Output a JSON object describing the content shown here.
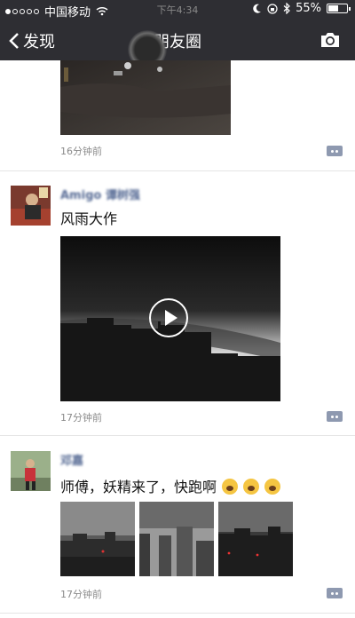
{
  "status": {
    "carrier": "中国移动",
    "time": "下午4:34",
    "battery": "55%",
    "battery_level": 0.55
  },
  "nav": {
    "back_label": "发现",
    "title": "朋友圈"
  },
  "posts": [
    {
      "time": "16分钟前"
    },
    {
      "name": "Amigo 谭树强",
      "text": "风雨大作",
      "time": "17分钟前"
    },
    {
      "name": "邓嘉",
      "text": "师傅，妖精来了，快跑啊",
      "time": "17分钟前"
    }
  ],
  "colors": {
    "bar": "#2e2e33",
    "name": "#576b95",
    "time": "#8a8a8a"
  },
  "icons": [
    "back-chevron-icon",
    "camera-icon",
    "wifi-icon",
    "moon-icon",
    "lock-icon",
    "bluetooth-icon",
    "comment-icon",
    "play-icon",
    "scream-emoji-icon"
  ]
}
